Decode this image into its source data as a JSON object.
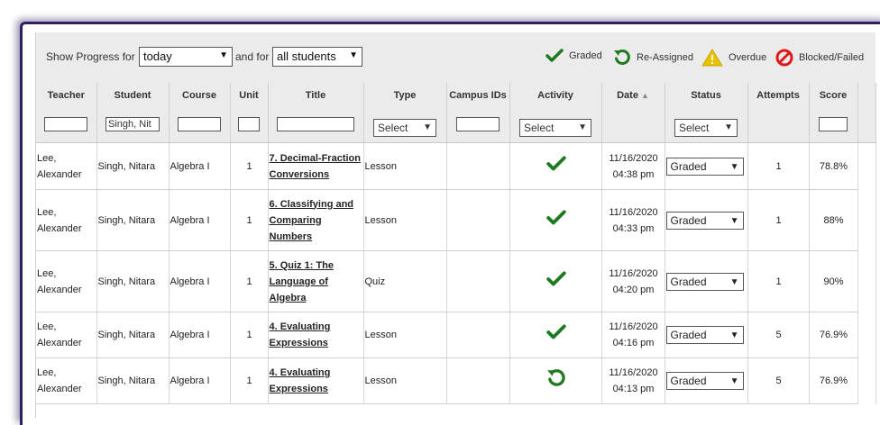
{
  "filter": {
    "show_label": "Show Progress for",
    "period_value": "today",
    "and_label": "and for",
    "students_value": "all students"
  },
  "legend": [
    {
      "label": "Graded",
      "icon": "check-icon",
      "color": "#1e7a1e"
    },
    {
      "label": "Re-Assigned",
      "icon": "reassign-icon",
      "color": "#1e7a1e"
    },
    {
      "label": "Overdue",
      "icon": "warning-icon",
      "color": "#e8c200"
    },
    {
      "label": "Blocked/Failed",
      "icon": "blocked-icon",
      "color": "#e01818"
    }
  ],
  "columns": {
    "teacher": "Teacher",
    "student": "Student",
    "course": "Course",
    "unit": "Unit",
    "title": "Title",
    "type": "Type",
    "campus": "Campus IDs",
    "activity": "Activity",
    "date": "Date",
    "status": "Status",
    "attempts": "Attempts",
    "score": "Score"
  },
  "header_filters": {
    "student_value": "Singh, Nit",
    "type_select": "Select",
    "activity_select": "Select",
    "status_select": "Select"
  },
  "rows": [
    {
      "teacher_l1": "Lee,",
      "teacher_l2": "Alexander",
      "student": "Singh, Nitara",
      "course": "Algebra I",
      "unit": "1",
      "title_lines": [
        "7. Decimal-Fraction",
        "Conversions"
      ],
      "type": "Lesson",
      "activity": "graded",
      "date": "11/16/2020",
      "time": "04:38 pm",
      "status": "Graded",
      "attempts": "1",
      "score": "78.8%"
    },
    {
      "teacher_l1": "Lee,",
      "teacher_l2": "Alexander",
      "student": "Singh, Nitara",
      "course": "Algebra I",
      "unit": "1",
      "title_lines": [
        "6. Classifying and",
        "Comparing",
        "Numbers"
      ],
      "type": "Lesson",
      "activity": "graded",
      "date": "11/16/2020",
      "time": "04:33 pm",
      "status": "Graded",
      "attempts": "1",
      "score": "88%"
    },
    {
      "teacher_l1": "Lee,",
      "teacher_l2": "Alexander",
      "student": "Singh, Nitara",
      "course": "Algebra I",
      "unit": "1",
      "title_lines": [
        "5. Quiz 1: The",
        "Language of",
        "Algebra"
      ],
      "type": "Quiz",
      "activity": "graded",
      "date": "11/16/2020",
      "time": "04:20 pm",
      "status": "Graded",
      "attempts": "1",
      "score": "90%"
    },
    {
      "teacher_l1": "Lee,",
      "teacher_l2": "Alexander",
      "student": "Singh, Nitara",
      "course": "Algebra I",
      "unit": "1",
      "title_lines": [
        "4. Evaluating",
        "Expressions"
      ],
      "type": "Lesson",
      "activity": "graded",
      "date": "11/16/2020",
      "time": "04:16 pm",
      "status": "Graded",
      "attempts": "5",
      "score": "76.9%"
    },
    {
      "teacher_l1": "Lee,",
      "teacher_l2": "Alexander",
      "student": "Singh, Nitara",
      "course": "Algebra I",
      "unit": "1",
      "title_lines": [
        "4. Evaluating",
        "Expressions"
      ],
      "type": "Lesson",
      "activity": "reassigned",
      "date": "11/16/2020",
      "time": "04:13 pm",
      "status": "Graded",
      "attempts": "5",
      "score": "76.9%"
    }
  ]
}
